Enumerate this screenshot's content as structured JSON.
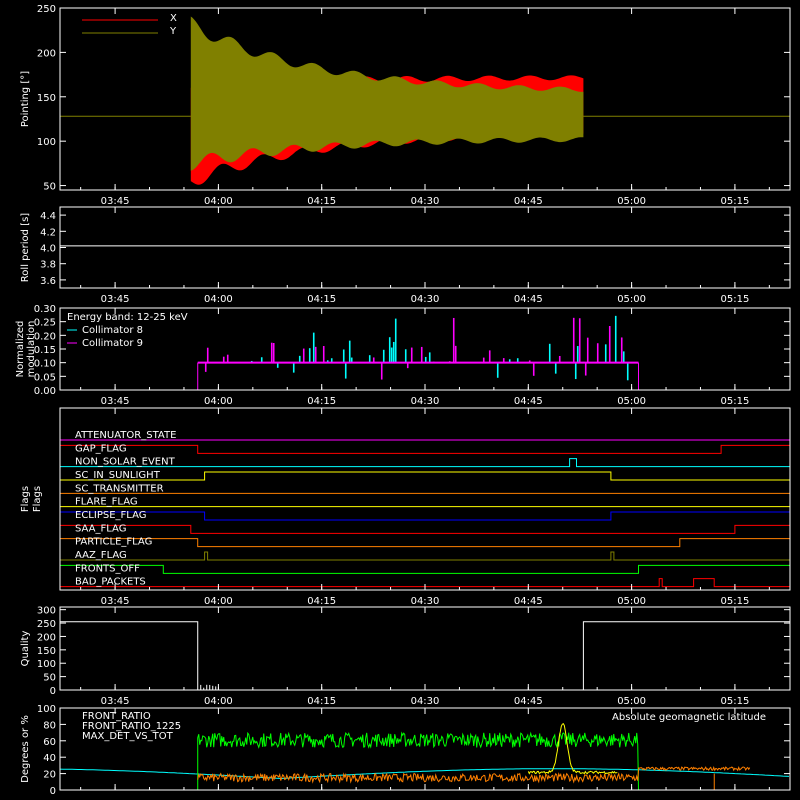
{
  "colors": {
    "x": "#ff0000",
    "y": "#808000",
    "white": "#ffffff",
    "cyan": "#00ffff",
    "magenta": "#ff00ff",
    "green": "#00ff00",
    "orange": "#ff8000",
    "yellow": "#ffff00",
    "blue": "#0000ff"
  },
  "time_axis": {
    "start": "03:37",
    "end": "05:23",
    "ticks": [
      "03:45",
      "04:00",
      "04:15",
      "04:30",
      "04:45",
      "05:00",
      "05:15"
    ]
  },
  "chart_data": [
    {
      "type": "area",
      "ylabel": "Pointing [°]",
      "ylim": [
        45,
        250
      ],
      "yticks": [
        50,
        100,
        150,
        200,
        250
      ],
      "legend": [
        "X",
        "Y"
      ],
      "legend_placement": "top-left",
      "series": [
        {
          "name": "X",
          "baseline": 128,
          "envelope_start": "03:56",
          "envelope_end": "04:53",
          "initial_min": 55,
          "initial_max": 160,
          "final_min": 110,
          "final_max": 172
        },
        {
          "name": "Y",
          "baseline": 128,
          "envelope_start": "03:56",
          "envelope_end": "04:53",
          "initial_min": 75,
          "initial_max": 232,
          "final_min": 103,
          "final_max": 155
        }
      ]
    },
    {
      "type": "line",
      "ylabel": "Roll period [s]",
      "ylim": [
        3.5,
        4.5
      ],
      "yticks": [
        "3.6",
        "3.8",
        "4.0",
        "4.2",
        "4.4"
      ],
      "series": [
        {
          "value": 4.02
        }
      ]
    },
    {
      "type": "bar",
      "ylabel": "Normalized modulation",
      "ylim": [
        0,
        0.3
      ],
      "yticks": [
        "0.00",
        "0.05",
        "0.10",
        "0.15",
        "0.20",
        "0.25",
        "0.30"
      ],
      "annotation": "Energy band: 12-25 keV",
      "legend": [
        "Collimator 8",
        "Collimator 9"
      ],
      "data_start": "03:57",
      "data_end": "05:01",
      "baseline": 0.1
    },
    {
      "type": "line",
      "ylabel": "Flags",
      "flags": [
        {
          "name": "ATTENUATOR_STATE",
          "color": "#ff00ff",
          "segments": []
        },
        {
          "name": "GAP_FLAG",
          "color": "#ff0000",
          "segments": [
            [
              "03:37",
              "03:57"
            ],
            [
              "05:13",
              "05:23"
            ]
          ]
        },
        {
          "name": "NON_SOLAR_EVENT",
          "color": "#00ffff",
          "segments": [
            [
              "04:51",
              "04:52"
            ]
          ]
        },
        {
          "name": "SC_IN_SUNLIGHT",
          "color": "#ffff00",
          "segments": [
            [
              "03:58",
              "04:57"
            ]
          ]
        },
        {
          "name": "SC_TRANSMITTER",
          "color": "#ff8000",
          "segments": []
        },
        {
          "name": "FLARE_FLAG",
          "color": "#ffff00",
          "segments": []
        },
        {
          "name": "ECLIPSE_FLAG",
          "color": "#0000ff",
          "segments": [
            [
              "03:37",
              "03:58"
            ],
            [
              "04:57",
              "05:23"
            ]
          ]
        },
        {
          "name": "SAA_FLAG",
          "color": "#ff0000",
          "segments": [
            [
              "03:37",
              "03:56"
            ],
            [
              "05:15",
              "05:23"
            ]
          ]
        },
        {
          "name": "PARTICLE_FLAG",
          "color": "#ff8000",
          "segments": [
            [
              "03:37",
              "03:57"
            ],
            [
              "05:07",
              "05:23"
            ]
          ]
        },
        {
          "name": "AAZ_FLAG",
          "color": "#808000",
          "segments": [
            [
              "03:58",
              "03:58"
            ],
            [
              "04:57",
              "04:57"
            ]
          ]
        },
        {
          "name": "FRONTS_OFF",
          "color": "#00ff00",
          "segments": [
            [
              "03:37",
              "03:52"
            ],
            [
              "05:01",
              "05:23"
            ]
          ]
        },
        {
          "name": "BAD_PACKETS",
          "color": "#ff0000",
          "segments": [
            [
              "05:04",
              "05:04"
            ],
            [
              "05:09",
              "05:12"
            ]
          ]
        }
      ]
    },
    {
      "type": "line",
      "ylabel": "Quality",
      "ylim": [
        0,
        310
      ],
      "yticks": [
        0,
        50,
        100,
        150,
        200,
        250,
        300
      ],
      "series": [
        {
          "segments": [
            [
              "03:37",
              "03:57",
              255
            ],
            [
              "04:53",
              "05:23",
              255
            ]
          ]
        }
      ]
    },
    {
      "type": "line",
      "ylabel": "Degrees or %",
      "ylim": [
        0,
        100
      ],
      "yticks": [
        0,
        20,
        40,
        60,
        80,
        100
      ],
      "legend": [
        "FRONT_RATIO",
        "FRONT_RATIO_1225",
        "MAX_DET_VS_TOT"
      ],
      "right_label": "Absolute geomagnetic latitude",
      "data_start": "03:57",
      "data_end": "05:01"
    }
  ]
}
